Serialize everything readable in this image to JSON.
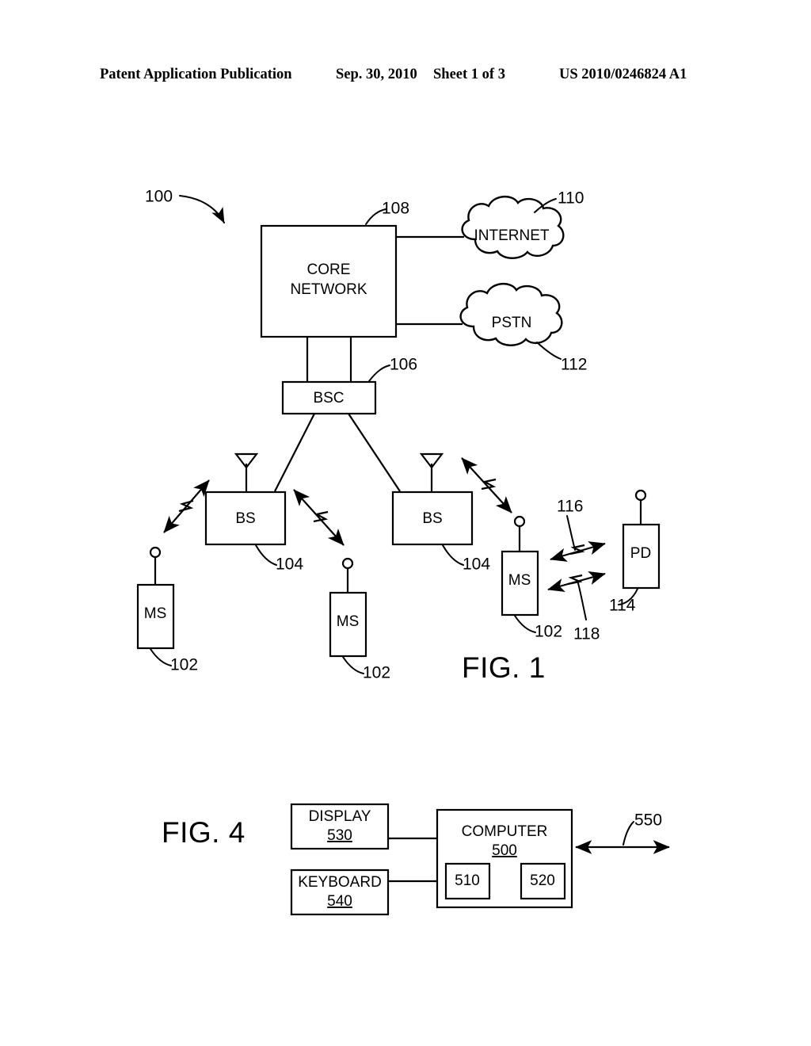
{
  "header": {
    "publication": "Patent Application Publication",
    "date": "Sep. 30, 2010",
    "sheet": "Sheet 1 of 3",
    "patent_number": "US 2010/0246824 A1"
  },
  "figures": [
    {
      "id": "fig1",
      "label": "FIG. 1",
      "system_ref": "100",
      "blocks": [
        {
          "name": "core-network",
          "line1": "CORE",
          "line2": "NETWORK",
          "ref": "108"
        },
        {
          "name": "bsc",
          "line1": "BSC",
          "ref": "106"
        },
        {
          "name": "bs-left",
          "line1": "BS",
          "ref": "104"
        },
        {
          "name": "bs-right",
          "line1": "BS",
          "ref": "104"
        },
        {
          "name": "ms-left",
          "line1": "MS",
          "ref": "102"
        },
        {
          "name": "ms-middle",
          "line1": "MS",
          "ref": "102"
        },
        {
          "name": "ms-right",
          "line1": "MS",
          "ref": "102"
        },
        {
          "name": "pd",
          "line1": "PD",
          "ref": "114"
        }
      ],
      "clouds": [
        {
          "name": "internet",
          "label": "INTERNET",
          "ref": "110"
        },
        {
          "name": "pstn",
          "label": "PSTN",
          "ref": "112"
        }
      ],
      "links": [
        {
          "name": "ms-pd-link-upper",
          "ref": "116"
        },
        {
          "name": "ms-pd-link-lower",
          "ref": "118"
        }
      ]
    },
    {
      "id": "fig4",
      "label": "FIG. 4",
      "blocks": [
        {
          "name": "display",
          "label": "DISPLAY",
          "ref": "530"
        },
        {
          "name": "keyboard",
          "label": "KEYBOARD",
          "ref": "540"
        },
        {
          "name": "computer",
          "label": "COMPUTER",
          "ref": "500"
        },
        {
          "name": "component-510",
          "label": "",
          "ref": "510"
        },
        {
          "name": "component-520",
          "label": "",
          "ref": "520"
        }
      ],
      "connection_ref": "550"
    }
  ],
  "colors": {
    "ink": "#000000",
    "paper": "#ffffff"
  }
}
